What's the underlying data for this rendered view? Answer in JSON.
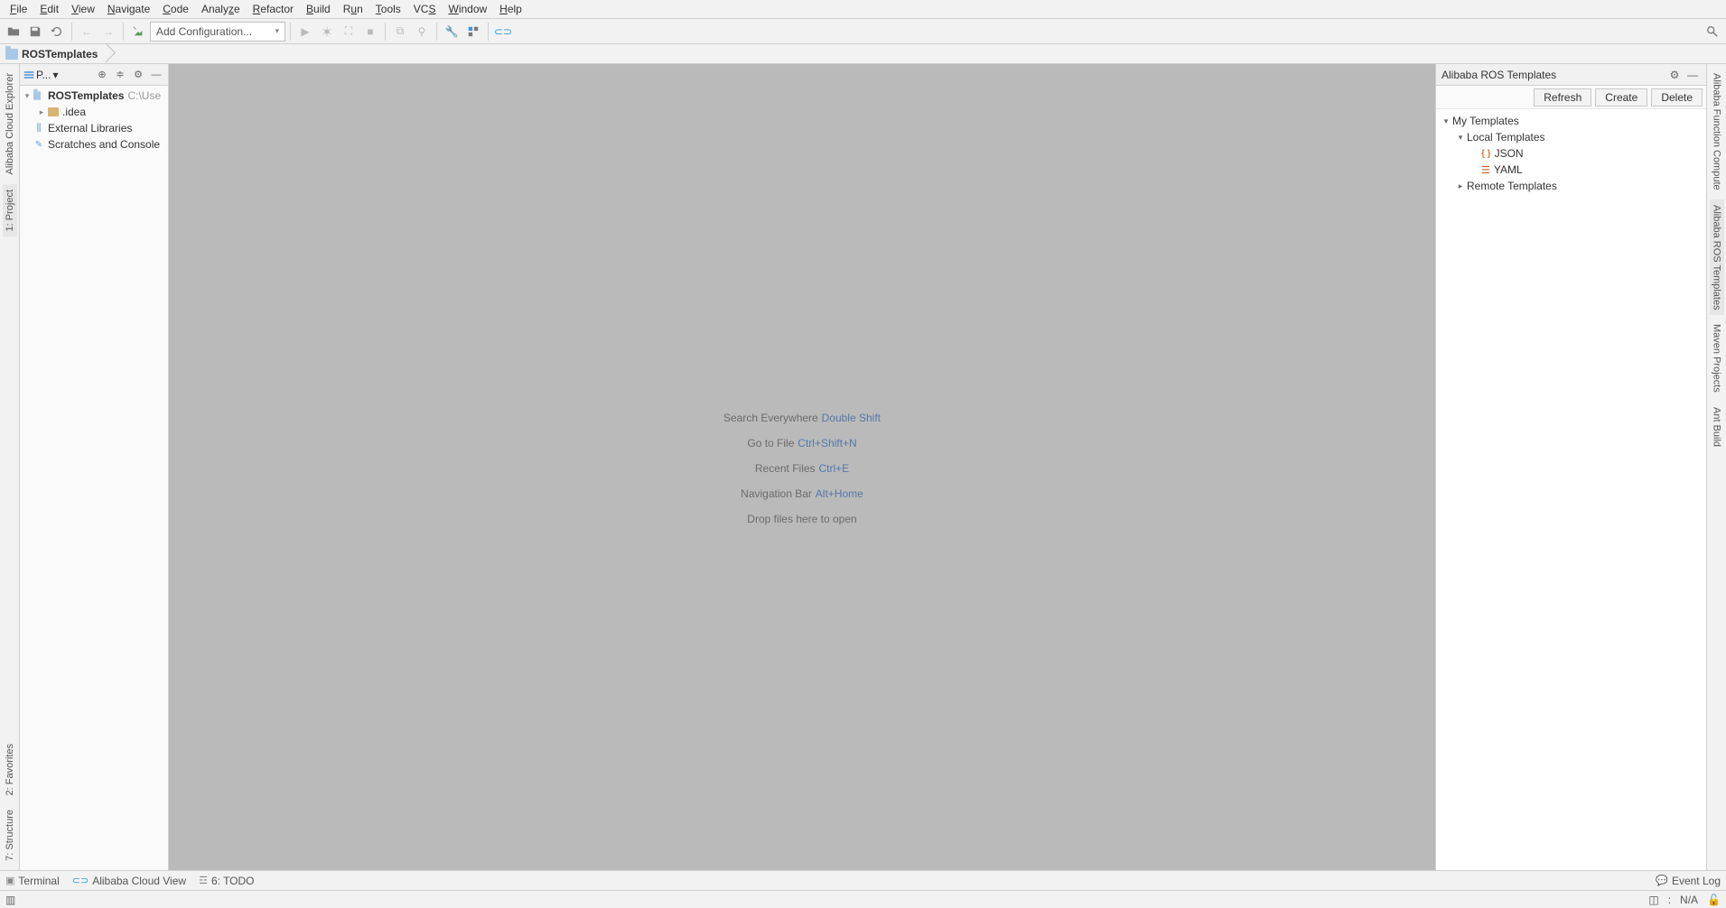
{
  "menu": [
    "File",
    "Edit",
    "View",
    "Navigate",
    "Code",
    "Analyze",
    "Refactor",
    "Build",
    "Run",
    "Tools",
    "VCS",
    "Window",
    "Help"
  ],
  "toolbar": {
    "run_config": "Add Configuration..."
  },
  "breadcrumb": {
    "root": "ROSTemplates"
  },
  "project_panel": {
    "dropdown_label": "P...",
    "root": {
      "name": "ROSTemplates",
      "path": "C:\\Use"
    },
    "children": [
      {
        "name": ".idea",
        "type": "folder"
      }
    ],
    "external": "External Libraries",
    "scratches": "Scratches and Console"
  },
  "editor_hints": [
    {
      "label": "Search Everywhere",
      "kb": "Double Shift"
    },
    {
      "label": "Go to File",
      "kb": "Ctrl+Shift+N"
    },
    {
      "label": "Recent Files",
      "kb": "Ctrl+E"
    },
    {
      "label": "Navigation Bar",
      "kb": "Alt+Home"
    },
    {
      "label": "Drop files here to open",
      "kb": ""
    }
  ],
  "ros_panel": {
    "title": "Alibaba ROS Templates",
    "buttons": {
      "refresh": "Refresh",
      "create": "Create",
      "delete": "Delete"
    },
    "tree": {
      "my": "My Templates",
      "local": "Local Templates",
      "json": "JSON",
      "yaml": "YAML",
      "remote": "Remote Templates"
    }
  },
  "left_tabs": {
    "project": "1: Project",
    "explorer": "Alibaba Cloud Explorer",
    "structure": "7: Structure",
    "favorites": "2: Favorites"
  },
  "right_tabs": {
    "fc": "Alibaba Function Compute",
    "ros": "Alibaba ROS Templates",
    "maven": "Maven Projects",
    "ant": "Ant Build"
  },
  "bottom": {
    "terminal": "Terminal",
    "cloudview": "Alibaba Cloud View",
    "todo": "6: TODO",
    "eventlog": "Event Log"
  },
  "status": {
    "na": "N/A"
  }
}
